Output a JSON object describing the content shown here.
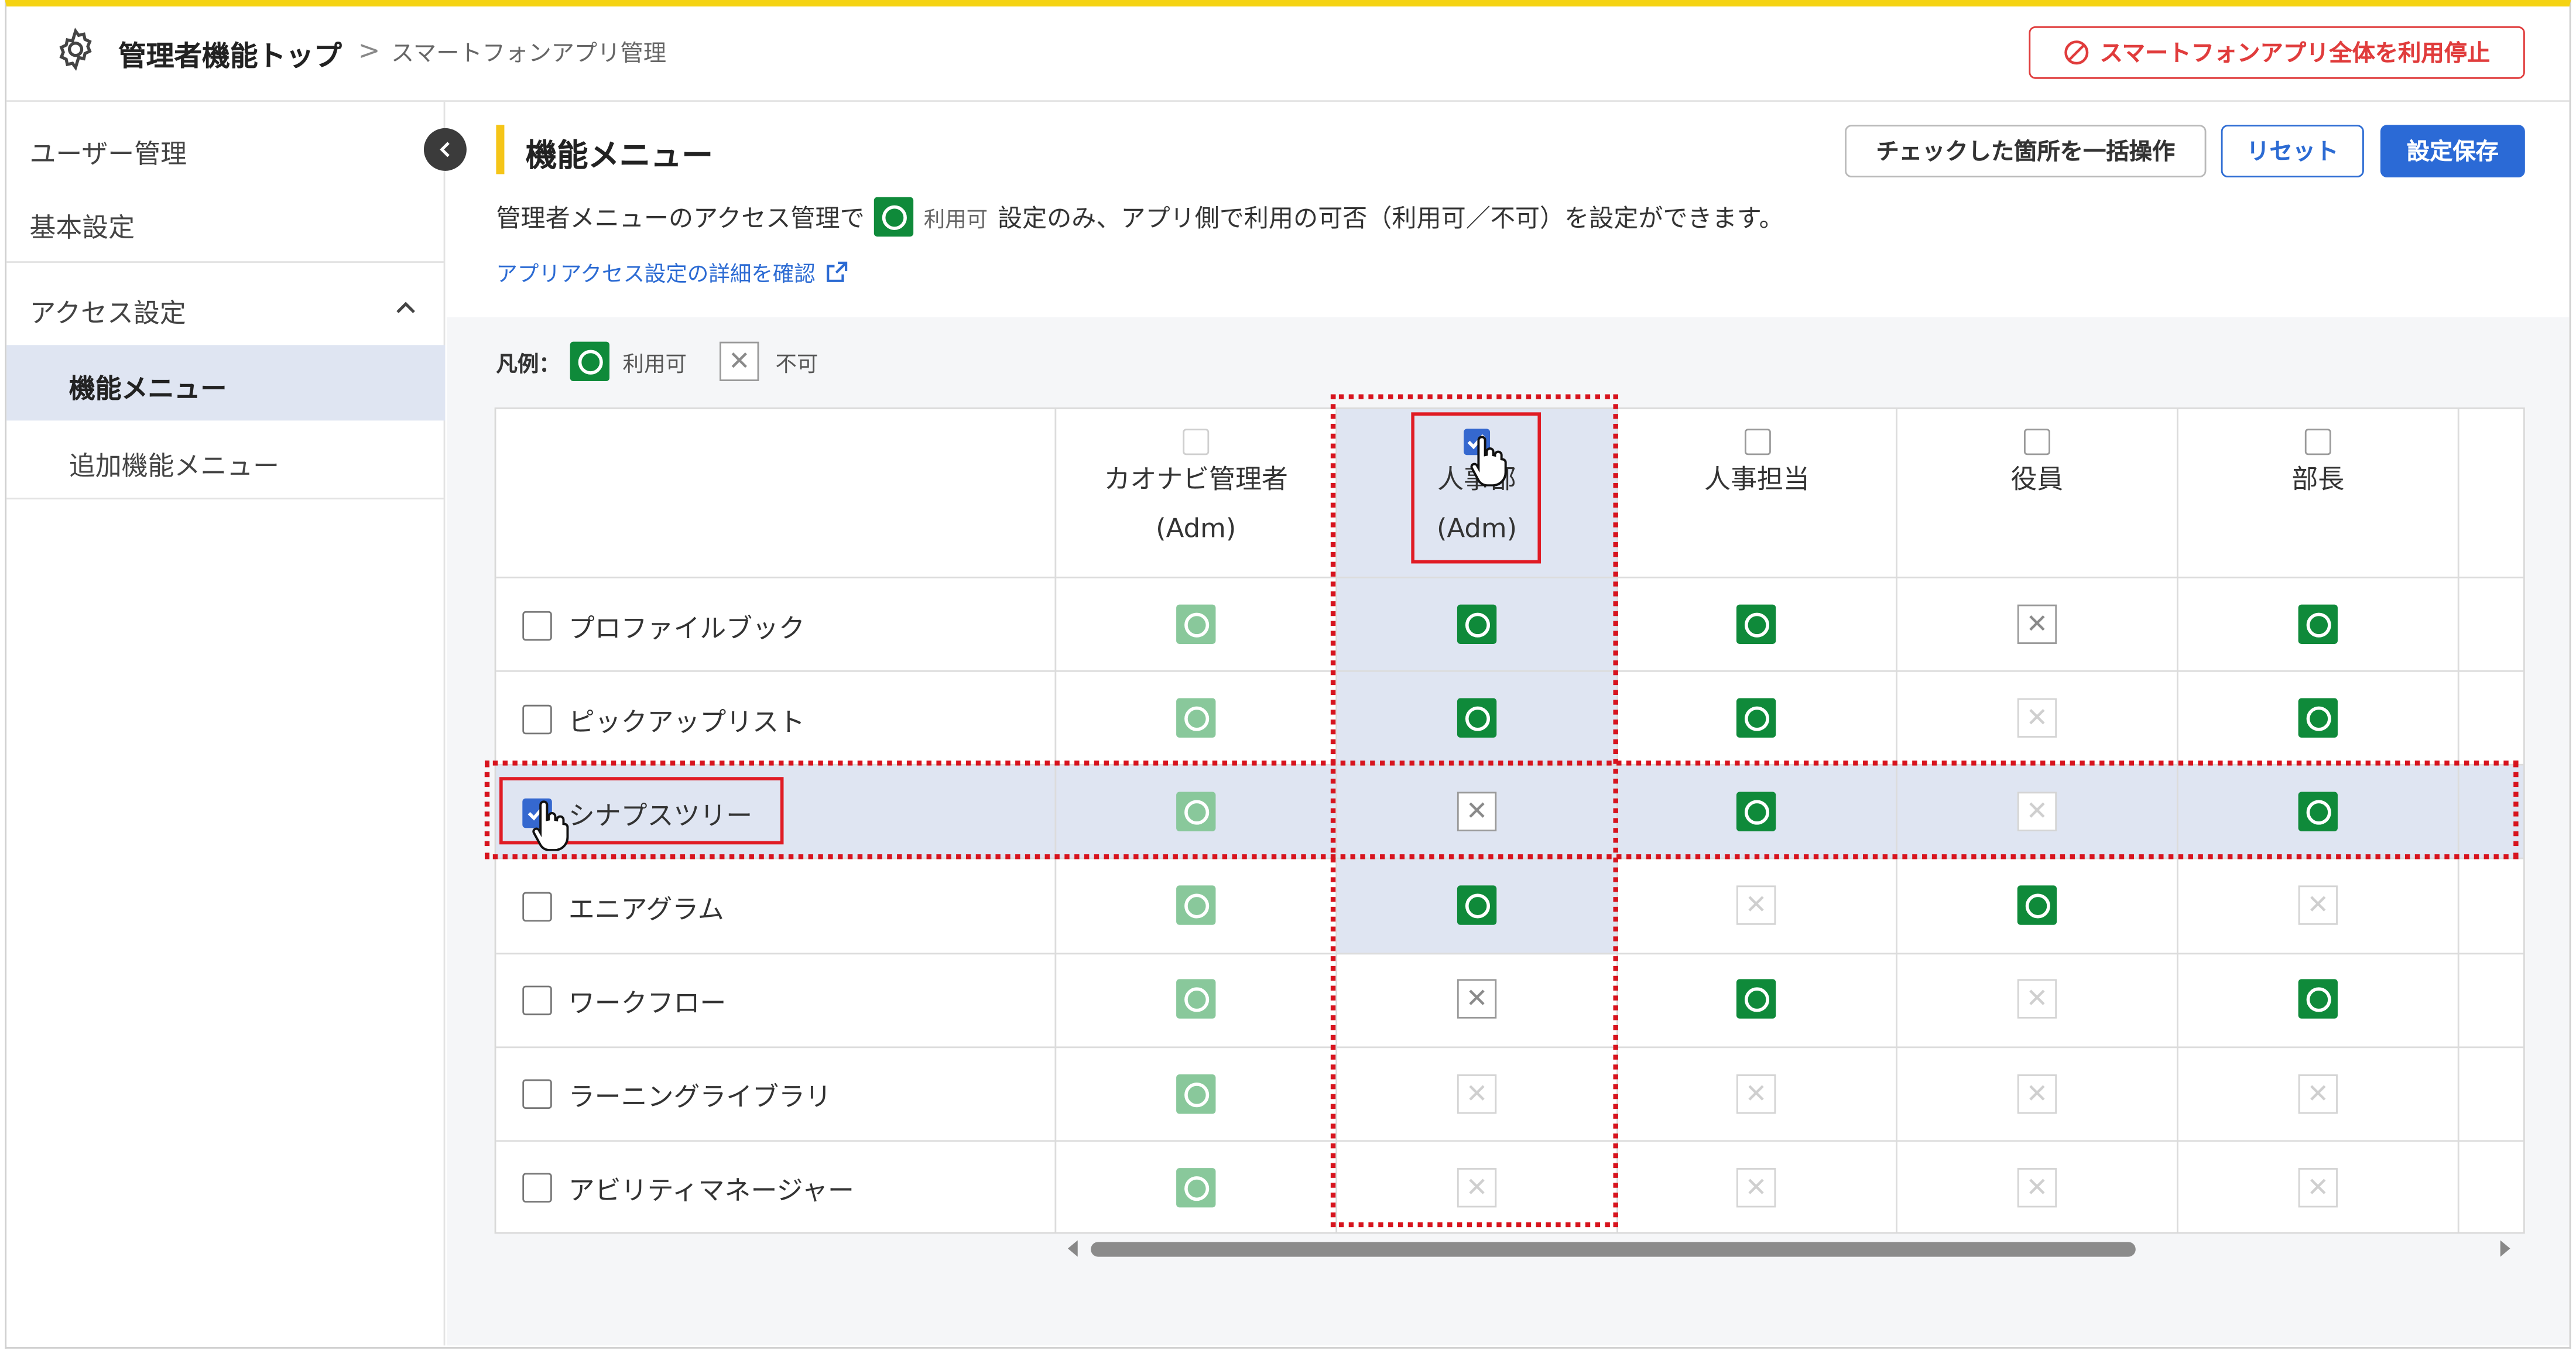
{
  "breadcrumb": {
    "top": "管理者機能トップ",
    "separator": ">",
    "current": "スマートフォンアプリ管理"
  },
  "stop_button": "スマートフォンアプリ全体を利用停止",
  "sidebar": {
    "items": [
      {
        "label": "ユーザー管理"
      },
      {
        "label": "基本設定"
      },
      {
        "label": "アクセス設定"
      },
      {
        "label": "機能メニュー"
      },
      {
        "label": "追加機能メニュー"
      }
    ]
  },
  "main": {
    "title": "機能メニュー",
    "bulk_button": "チェックした箇所を一括操作",
    "reset_button": "リセット",
    "save_button": "設定保存",
    "desc_before": "管理者メニューのアクセス管理で",
    "desc_small": "利用可",
    "desc_after": "設定のみ、アプリ側で利用の可否（利用可／不可）を設定ができます。",
    "link": "アプリアクセス設定の詳細を確認"
  },
  "legend": {
    "label": "凡例：",
    "ok": "利用可",
    "ng": "不可"
  },
  "table": {
    "columns": [
      {
        "name": "カオナビ管理者",
        "sub": "(Adm)"
      },
      {
        "name": "人事部",
        "sub": "(Adm)"
      },
      {
        "name": "人事担当",
        "sub": ""
      },
      {
        "name": "役員",
        "sub": ""
      },
      {
        "name": "部長",
        "sub": ""
      }
    ],
    "rows": [
      {
        "label": "プロファイルブック"
      },
      {
        "label": "ピックアップリスト"
      },
      {
        "label": "シナプスツリー"
      },
      {
        "label": "エニアグラム"
      },
      {
        "label": "ワークフロー"
      },
      {
        "label": "ラーニングライブラリ"
      },
      {
        "label": "アビリティマネージャー"
      }
    ]
  },
  "colors": {
    "accent": "#2b6ad6",
    "danger": "#e03c3c",
    "ok_green": "#0f8a3a",
    "highlight": "#dfe5f2",
    "topbar_yellow": "#f5d312"
  }
}
